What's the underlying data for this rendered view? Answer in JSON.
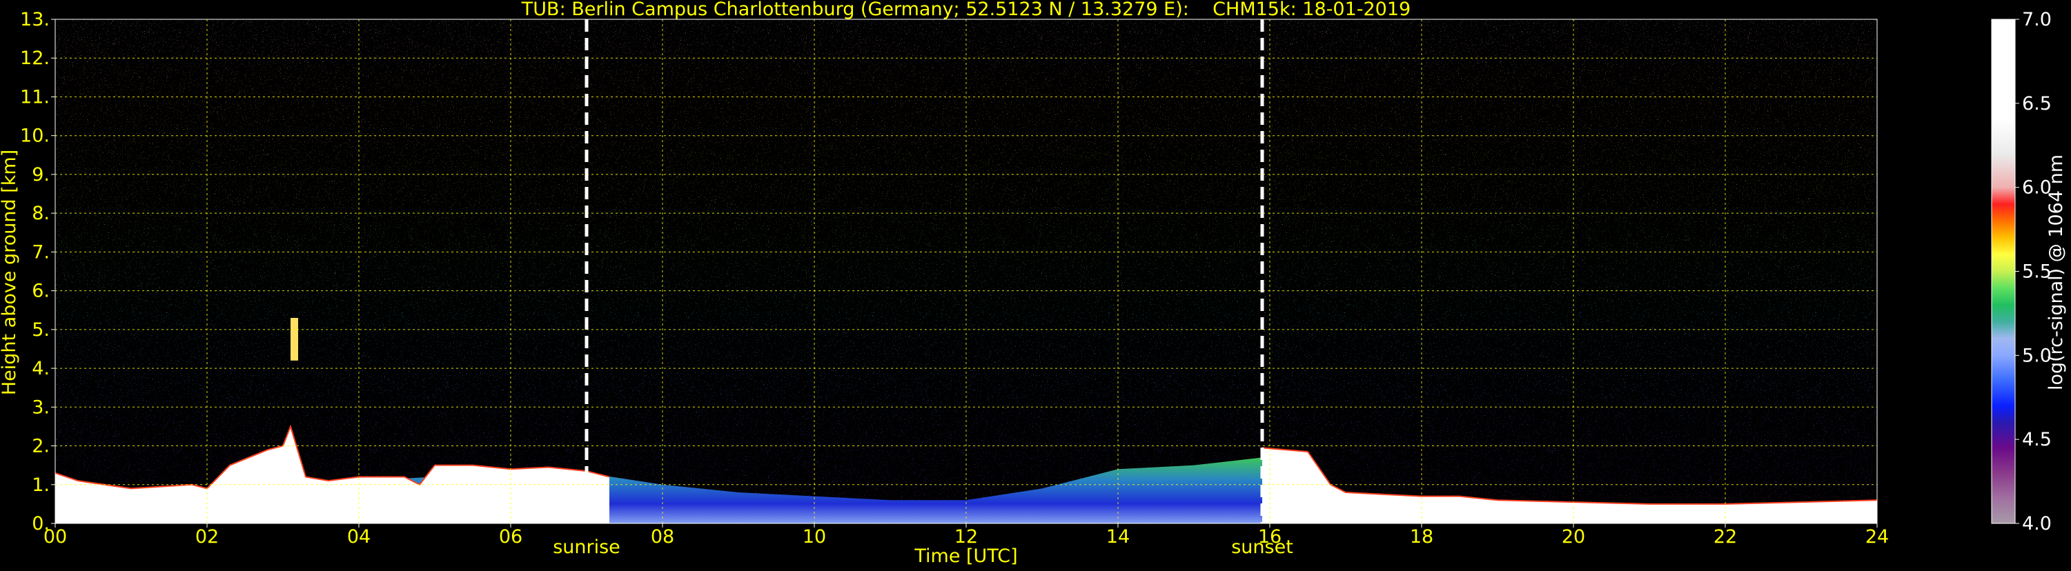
{
  "chart_data": {
    "type": "heatmap",
    "title": "TUB: Berlin Campus Charlottenburg (Germany; 52.5123 N / 13.3279 E):    CHM15k: 18-01-2019",
    "xlabel": "Time [UTC]",
    "ylabel": "Height above ground [km]",
    "xlim": [
      0,
      24
    ],
    "ylim": [
      0,
      13
    ],
    "x_ticks": [
      0,
      2,
      4,
      6,
      8,
      10,
      12,
      14,
      16,
      18,
      20,
      22,
      24
    ],
    "x_tick_labels": [
      "00",
      "02",
      "04",
      "06",
      "08",
      "10",
      "12",
      "14",
      "16",
      "18",
      "20",
      "22",
      "24"
    ],
    "y_ticks": [
      0,
      1,
      2,
      3,
      4,
      5,
      6,
      7,
      8,
      9,
      10,
      11,
      12,
      13
    ],
    "y_tick_labels": [
      "0.",
      "1.",
      "2.",
      "3.",
      "4.",
      "5.",
      "6.",
      "7.",
      "8.",
      "9.",
      "10.",
      "11.",
      "12.",
      "13."
    ],
    "grid": true,
    "grid_color": "#ffff00",
    "text_color": "#ffff00",
    "background": "#000000",
    "annotations": [
      {
        "label": "sunrise",
        "x": 7.0,
        "line_color": "#ffffff",
        "line_style": "dashed"
      },
      {
        "label": "sunset",
        "x": 15.9,
        "line_color": "#ffffff",
        "line_style": "dashed"
      }
    ],
    "features": [
      {
        "kind": "strong-backscatter",
        "x": [
          0.0,
          0.3,
          1.0,
          1.8,
          2.0,
          2.3,
          2.8,
          3.0,
          3.1,
          3.3,
          3.6,
          4.0,
          4.6,
          4.8,
          5.0,
          5.5,
          6.0,
          6.5,
          7.0,
          7.3
        ],
        "y": [
          1.3,
          1.1,
          0.9,
          1.0,
          0.9,
          1.5,
          1.9,
          2.0,
          2.5,
          1.2,
          1.1,
          1.2,
          1.2,
          1.0,
          1.5,
          1.5,
          1.4,
          1.45,
          1.35,
          1.2
        ]
      },
      {
        "kind": "strong-backscatter",
        "x": [
          15.9,
          16.2,
          16.5,
          16.8,
          17.0,
          17.5,
          18.0,
          18.5,
          19.0,
          20.0,
          21.0,
          22.0,
          23.0,
          24.0
        ],
        "y": [
          1.95,
          1.9,
          1.85,
          1.0,
          0.8,
          0.75,
          0.7,
          0.7,
          0.6,
          0.55,
          0.5,
          0.5,
          0.55,
          0.6
        ]
      },
      {
        "kind": "boundary-layer",
        "x": [
          3.0,
          4.0,
          5.0,
          6.0,
          7.0,
          8.0,
          9.0,
          10.0,
          11.0,
          12.0,
          13.0,
          14.0,
          15.0,
          15.9
        ],
        "y": [
          1.1,
          1.1,
          1.2,
          1.3,
          1.3,
          1.0,
          0.8,
          0.7,
          0.6,
          0.6,
          0.9,
          1.4,
          1.5,
          1.7
        ]
      },
      {
        "kind": "aerosol-layer",
        "x": [
          16.0,
          17.0,
          18.0,
          19.0,
          20.0,
          21.0,
          22.0,
          23.0,
          24.0
        ],
        "y": [
          0.7,
          0.6,
          0.5,
          0.45,
          0.4,
          0.4,
          0.45,
          0.45,
          0.5
        ]
      },
      {
        "kind": "elevated-layer",
        "x": [
          3.1,
          3.2
        ],
        "y": [
          4.2,
          5.3
        ]
      }
    ],
    "colorbar": {
      "label": "log(rc-signal) @ 1064 nm",
      "min": 4.0,
      "max": 7.0,
      "ticks": [
        4.0,
        4.5,
        5.0,
        5.5,
        6.0,
        6.5,
        7.0
      ],
      "tick_labels": [
        "4.0",
        "4.5",
        "5.0",
        "5.5",
        "6.0",
        "6.5",
        "7.0"
      ],
      "stops": [
        {
          "v": 4.0,
          "c": "#a89aa8"
        },
        {
          "v": 4.15,
          "c": "#a070a0"
        },
        {
          "v": 4.3,
          "c": "#8a3a8a"
        },
        {
          "v": 4.45,
          "c": "#6a0a8a"
        },
        {
          "v": 4.6,
          "c": "#2a1ab0"
        },
        {
          "v": 4.7,
          "c": "#0a20ff"
        },
        {
          "v": 4.85,
          "c": "#3c6cff"
        },
        {
          "v": 5.0,
          "c": "#8aa8ff"
        },
        {
          "v": 5.1,
          "c": "#a0b8f0"
        },
        {
          "v": 5.2,
          "c": "#40b0a0"
        },
        {
          "v": 5.3,
          "c": "#20c060"
        },
        {
          "v": 5.4,
          "c": "#60e060"
        },
        {
          "v": 5.5,
          "c": "#c8f050"
        },
        {
          "v": 5.6,
          "c": "#ffff40"
        },
        {
          "v": 5.7,
          "c": "#ffc000"
        },
        {
          "v": 5.8,
          "c": "#ff7000"
        },
        {
          "v": 5.9,
          "c": "#ff2020"
        },
        {
          "v": 6.0,
          "c": "#f0b0b0"
        },
        {
          "v": 6.2,
          "c": "#ebebeb"
        },
        {
          "v": 6.4,
          "c": "#ffffff"
        },
        {
          "v": 7.0,
          "c": "#ffffff"
        }
      ]
    }
  }
}
